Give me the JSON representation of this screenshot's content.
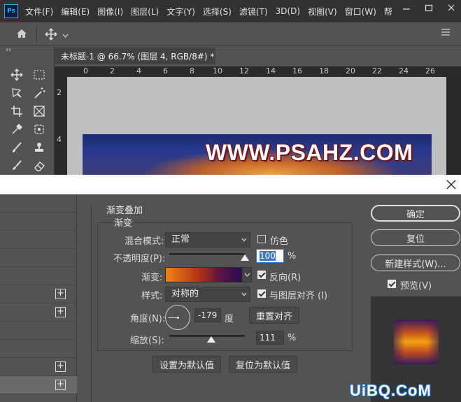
{
  "app": {
    "logo": "Ps",
    "menu": [
      "文件(F)",
      "编辑(E)",
      "图像(I)",
      "图层(L)",
      "文字(Y)",
      "选择(S)",
      "滤镜(T)",
      "3D(D)",
      "视图(V)",
      "窗口(W)",
      "帮"
    ],
    "window_controls": [
      "minimize-icon",
      "restore-icon",
      "close-icon"
    ]
  },
  "options_bar": {
    "icons": [
      "home-icon",
      "move-tool-icon",
      "chevron-down-icon"
    ]
  },
  "toolbar": {
    "collapse": "‹‹",
    "tools": [
      "move-icon",
      "marquee-icon",
      "lasso-icon",
      "magic-wand-icon",
      "crop-icon",
      "frame-icon",
      "eyedropper-icon",
      "patch-icon",
      "brush-icon",
      "stamp-icon",
      "history-brush-icon",
      "eraser-icon"
    ]
  },
  "document": {
    "tab_title": "未标题-1 @ 66.7% (图层 4, RGB/8#) *",
    "ruler_top": [
      "0",
      "2",
      "4",
      "6",
      "8",
      "10",
      "12",
      "14",
      "16",
      "18",
      "20",
      "22",
      "24",
      "26"
    ],
    "ruler_left": [
      "2",
      "4"
    ],
    "banner_text": "WWW.PSAHZ.COM"
  },
  "dialog": {
    "close_icon": "close-icon",
    "style_list_rows": 12,
    "section_title": "渐变叠加",
    "subsection_title": "渐变",
    "blend_mode": {
      "label": "混合模式:",
      "value": "正常"
    },
    "dither": {
      "label": "仿色",
      "checked": false
    },
    "opacity": {
      "label": "不透明度(P):",
      "value": "100",
      "unit": "%",
      "level": 1.0
    },
    "gradient": {
      "label": "渐变:",
      "colors": [
        "#f08410",
        "#b0301a",
        "#5a1440",
        "#2c0d52"
      ]
    },
    "reverse": {
      "label": "反向(R)",
      "checked": true
    },
    "style": {
      "label": "样式:",
      "value": "对称的"
    },
    "align_with_layer": {
      "label": "与图层对齐 (I)",
      "checked": true
    },
    "angle": {
      "label": "角度(N):",
      "value": "-179",
      "unit": "度"
    },
    "reset_align": "重置对齐",
    "scale": {
      "label": "缩放(S):",
      "value": "111",
      "unit": "%",
      "level": 0.555
    },
    "set_default": "设置为默认值",
    "reset_default": "复位为默认值",
    "ok": "确定",
    "reset": "复位",
    "new_style": "新建样式(W)...",
    "preview": {
      "label": "预览(V)",
      "checked": true
    }
  },
  "watermark": "UiBQ.CoM"
}
